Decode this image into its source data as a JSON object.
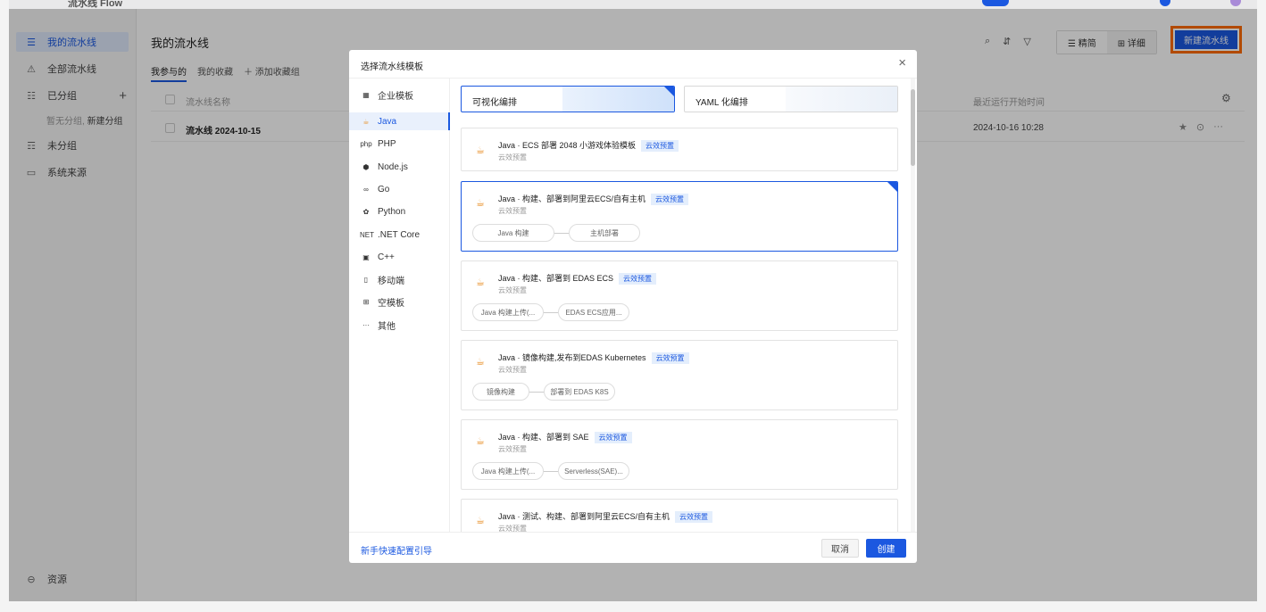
{
  "app": {
    "title": "流水线 Flow"
  },
  "sidebar": {
    "items": [
      {
        "icon": "☰",
        "label": "我的流水线"
      },
      {
        "icon": "⚠",
        "label": "全部流水线"
      },
      {
        "icon": "☷",
        "label": "已分组"
      },
      {
        "icon": "☶",
        "label": "未分组"
      },
      {
        "icon": "▭",
        "label": "系统来源"
      }
    ],
    "empty_group_text": "暂无分组,",
    "new_group_link": "新建分组",
    "bottom_item": {
      "icon": "⊖",
      "label": "资源"
    }
  },
  "main": {
    "title": "我的流水线",
    "tabs": [
      "我参与的",
      "我的收藏",
      "＋ 添加收藏组"
    ],
    "tools": [
      "⌕",
      "⇵",
      "▽"
    ],
    "view_switch": [
      "☰ 精简",
      "⊞ 详细"
    ],
    "new_button": "新建流水线",
    "columns": {
      "name": "流水线名称",
      "last_run": "最近运行开始时间"
    },
    "rows": [
      {
        "name": "流水线 2024-10-15",
        "time": "2024-10-16 10:28"
      }
    ],
    "row_icons": [
      "★",
      "⊙",
      "···"
    ]
  },
  "modal": {
    "title": "选择流水线模板",
    "close": "×",
    "categories": [
      {
        "icon": "▦",
        "label": "企业模板"
      },
      {
        "icon": "☕",
        "label": "Java"
      },
      {
        "icon": "php",
        "label": "PHP"
      },
      {
        "icon": "⬢",
        "label": "Node.js"
      },
      {
        "icon": "∞",
        "label": "Go"
      },
      {
        "icon": "✿",
        "label": "Python"
      },
      {
        "icon": "NET",
        "label": ".NET Core"
      },
      {
        "icon": "▣",
        "label": "C++"
      },
      {
        "icon": "▯",
        "label": "移动端"
      },
      {
        "icon": "⊞",
        "label": "空模板"
      },
      {
        "icon": "···",
        "label": "其他"
      }
    ],
    "modes": [
      {
        "label": "可视化编排"
      },
      {
        "label": "YAML 化编排"
      }
    ],
    "badge_text": "云效预置",
    "templates": [
      {
        "title": "Java · ECS 部署 2048 小游戏体验模板",
        "sub": "云效预置",
        "steps": []
      },
      {
        "title": "Java · 构建、部署到阿里云ECS/自有主机",
        "sub": "云效预置",
        "steps": [
          "Java 构建",
          "主机部署"
        ]
      },
      {
        "title": "Java · 构建、部署到 EDAS ECS",
        "sub": "云效预置",
        "steps": [
          "Java 构建上传(...",
          "EDAS ECS应用..."
        ]
      },
      {
        "title": "Java · 镜像构建,发布到EDAS Kubernetes",
        "sub": "云效预置",
        "steps": [
          "镜像构建",
          "部署到 EDAS K8S"
        ]
      },
      {
        "title": "Java · 构建、部署到 SAE",
        "sub": "云效预置",
        "steps": [
          "Java 构建上传(...",
          "Serverless(SAE)..."
        ]
      },
      {
        "title": "Java · 测试、构建、部署到阿里云ECS/自有主机",
        "sub": "云效预置",
        "steps": []
      }
    ],
    "guide_link": "新手快速配置引导",
    "cancel": "取消",
    "create": "创建"
  },
  "colors": {
    "accent": "#1b58e0",
    "highlight": "#ff6a00",
    "java": "#e8902a"
  }
}
